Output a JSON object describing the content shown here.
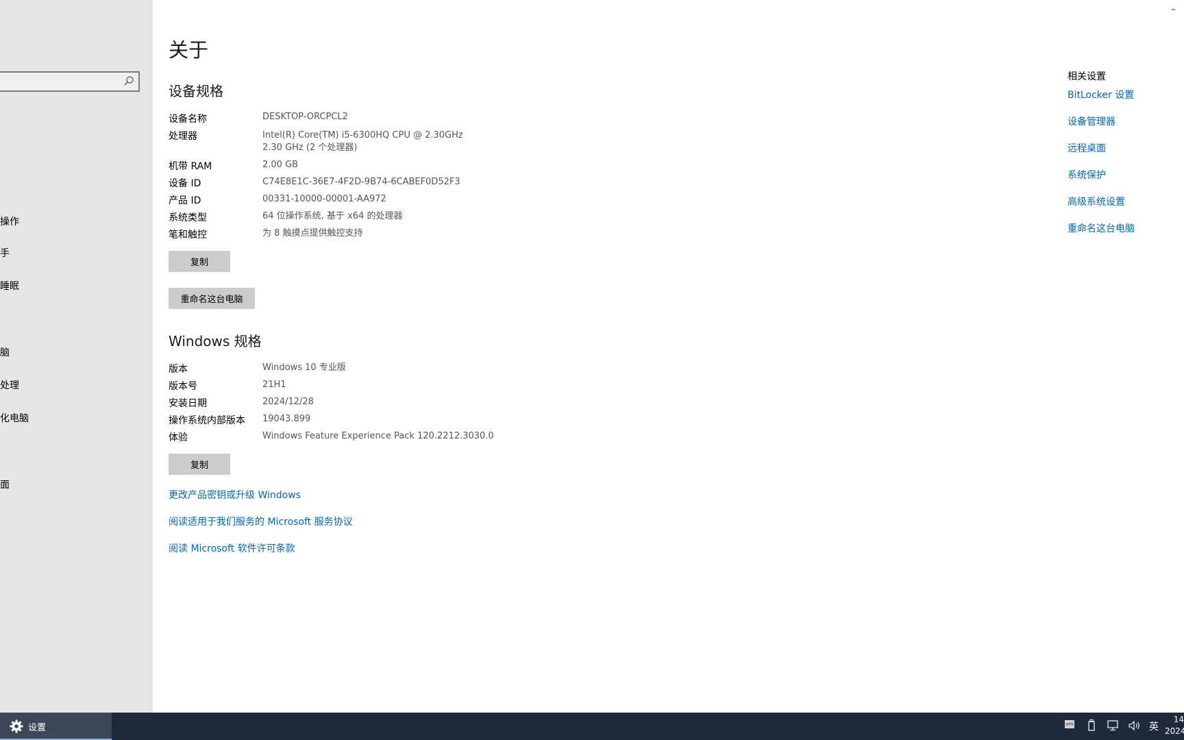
{
  "window": {
    "minimize_glyph": "–"
  },
  "nav": {
    "items": [
      "操作",
      "手",
      "睡眠",
      "脑",
      "处理",
      "化电脑",
      "面"
    ]
  },
  "page": {
    "title": "关于",
    "device_section": {
      "title": "设备规格",
      "rows": [
        {
          "label": "设备名称",
          "value": "DESKTOP-ORCPCL2"
        },
        {
          "label": "处理器",
          "value": "Intel(R) Core(TM) i5-6300HQ CPU @ 2.30GHz",
          "value2": "2.30 GHz  (2 个处理器)"
        },
        {
          "label": "机带 RAM",
          "value": "2.00 GB"
        },
        {
          "label": "设备 ID",
          "value": "C74E8E1C-36E7-4F2D-9B74-6CABEF0D52F3"
        },
        {
          "label": "产品 ID",
          "value": "00331-10000-00001-AA972"
        },
        {
          "label": "系统类型",
          "value": "64 位操作系统, 基于 x64 的处理器"
        },
        {
          "label": "笔和触控",
          "value": "为 8 触摸点提供触控支持"
        }
      ],
      "copy_button": "复制",
      "rename_button": "重命名这台电脑"
    },
    "windows_section": {
      "title": "Windows 规格",
      "rows": [
        {
          "label": "版本",
          "value": "Windows 10 专业版"
        },
        {
          "label": "版本号",
          "value": "21H1"
        },
        {
          "label": "安装日期",
          "value": "2024/12/28"
        },
        {
          "label": "操作系统内部版本",
          "value": "19043.899"
        },
        {
          "label": "体验",
          "value": "Windows Feature Experience Pack 120.2212.3030.0"
        }
      ],
      "copy_button": "复制"
    },
    "links": [
      "更改产品密钥或升级 Windows",
      "阅读适用于我们服务的 Microsoft 服务协议",
      "阅读 Microsoft 软件许可条款"
    ]
  },
  "related": {
    "title": "相关设置",
    "links": [
      "BitLocker 设置",
      "设备管理器",
      "远程桌面",
      "系统保护",
      "高级系统设置",
      "重命名这台电脑"
    ]
  },
  "taskbar": {
    "app_label": "设置",
    "tray": {
      "vm": "vm",
      "ime": "英"
    },
    "clock": {
      "time": "14",
      "date": "2024"
    }
  }
}
